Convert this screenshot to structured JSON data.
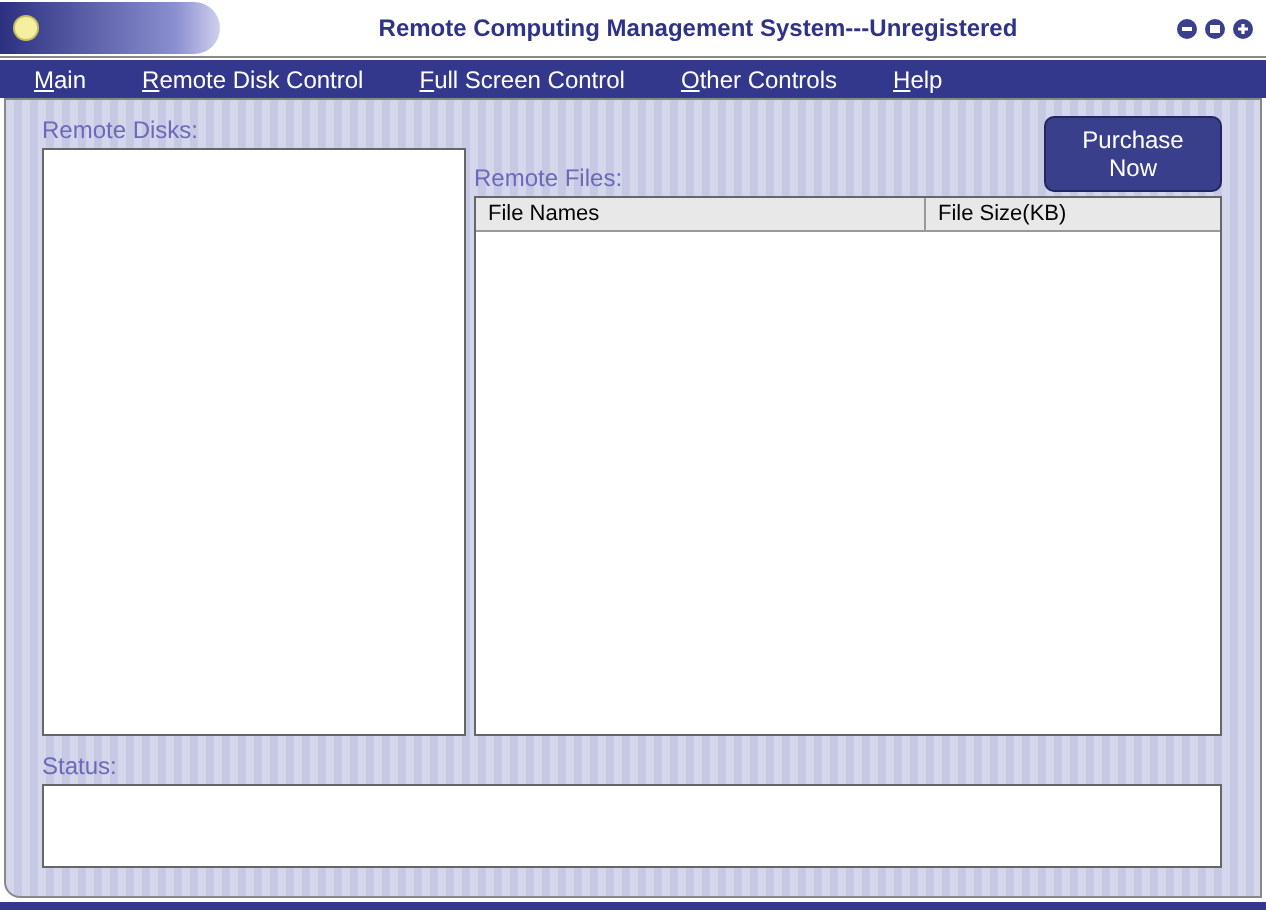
{
  "window": {
    "title": "Remote Computing Management System---Unregistered"
  },
  "menu": [
    "Main",
    "Remote Disk Control",
    "Full Screen Control",
    "Other Controls",
    "Help"
  ],
  "purchase_button": "Purchase Now",
  "remote_disks": {
    "label": "Remote Disks:"
  },
  "remote_files": {
    "label": "Remote Files:",
    "columns": [
      "File Names",
      "File Size(KB)"
    ]
  },
  "status": {
    "label": "Status:"
  }
}
